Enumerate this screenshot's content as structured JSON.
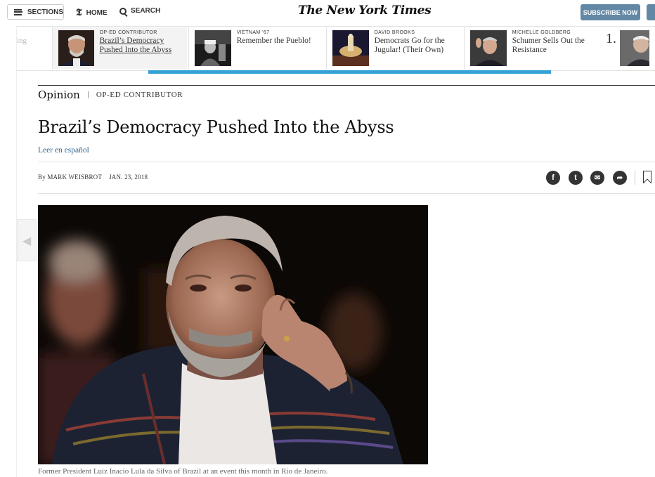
{
  "toolbar": {
    "sections_label": "SECTIONS",
    "home_label": "HOME",
    "search_label": "SEARCH",
    "masthead": "The New York Times",
    "subscribe_label": "SUBSCRIBE NOW"
  },
  "ribbon": {
    "partial_left": "ing",
    "items": [
      {
        "kicker": "OP-ED CONTRIBUTOR",
        "headline": "Brazil’s Democracy Pushed Into the Abyss",
        "active": true
      },
      {
        "kicker": "VIETNAM ’67",
        "headline": "Remember the Pueblo!",
        "active": false
      },
      {
        "kicker": "DAVID BROOKS",
        "headline": "Democrats Go for the Jugular! (Their Own)",
        "active": false
      },
      {
        "kicker": "MICHELLE GOLDBERG",
        "headline": "Schumer Sells Out the Resistance",
        "active": false
      }
    ],
    "rank": "1."
  },
  "article": {
    "section": "Opinion",
    "kicker": "OP-ED CONTRIBUTOR",
    "headline": "Brazil’s Democracy Pushed Into the Abyss",
    "translation_link": "Leer en español",
    "byline_prefix": "By",
    "author": "MARK WEISBROT",
    "date": "JAN. 23, 2018",
    "caption": "Former President Luiz Inacio Lula da Silva of Brazil at an event this month in Rio de Janeiro."
  },
  "share": {
    "facebook_glyph": "f",
    "twitter_glyph": "t",
    "email_glyph": "✉",
    "more_glyph": "➦"
  },
  "colors": {
    "subscribe_bg": "#6288a5",
    "link_blue": "#326891",
    "progress_blue": "#35a2d6"
  }
}
